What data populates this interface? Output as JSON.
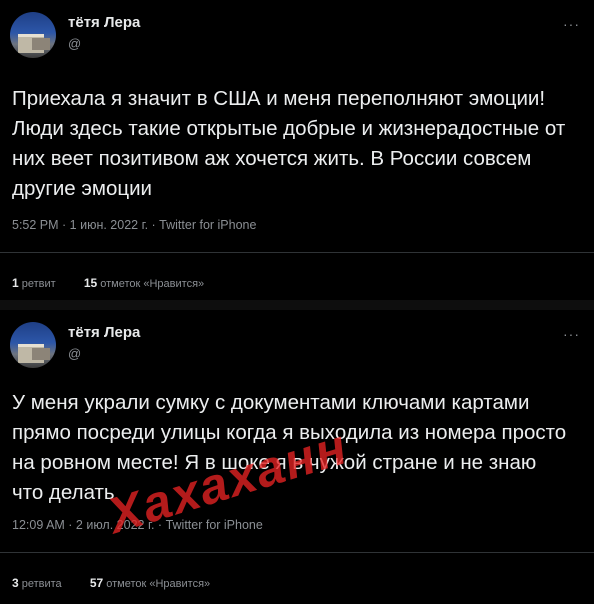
{
  "tweets": [
    {
      "name": "тётя Лера",
      "handle": "@",
      "more": "···",
      "text": "Приехала я значит в США и меня переполняют эмоции! Люди здесь такие открытые добрые и жизнерадостные от них веет позитивом аж хочется жить. В России совсем другие эмоции",
      "meta": "5:52 PM · 1 июн. 2022 г. · Twitter for iPhone",
      "retweets_count": "1",
      "retweets_label": "ретвит",
      "likes_count": "15",
      "likes_label": "отметок «Нравится»"
    },
    {
      "name": "тётя Лера",
      "handle": "@",
      "more": "···",
      "text": "У меня украли сумку с документами ключами картами прямо посреди улицы когда я выходила из номера просто на ровном месте! Я в шоке я в чужой стране и не знаю что делать",
      "meta": "12:09 AM · 2 июл. 2022 г. · Twitter for iPhone",
      "retweets_count": "3",
      "retweets_label": "ретвита",
      "likes_count": "57",
      "likes_label": "отметок «Нравится»"
    }
  ],
  "watermark": "Хахаханн"
}
